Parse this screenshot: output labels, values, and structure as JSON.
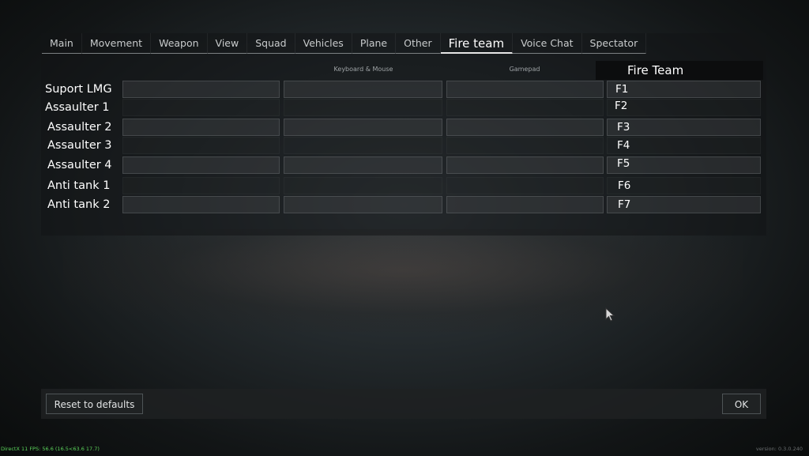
{
  "tabs": [
    {
      "label": "Main",
      "active": false
    },
    {
      "label": "Movement",
      "active": false
    },
    {
      "label": "Weapon",
      "active": false
    },
    {
      "label": "View",
      "active": false
    },
    {
      "label": "Squad",
      "active": false
    },
    {
      "label": "Vehicles",
      "active": false
    },
    {
      "label": "Plane",
      "active": false
    },
    {
      "label": "Other",
      "active": false
    },
    {
      "label": "Fire team",
      "active": true
    },
    {
      "label": "Voice Chat",
      "active": false
    },
    {
      "label": "Spectator",
      "active": false
    }
  ],
  "columns": {
    "keyboard_mouse": "Keyboard & Mouse",
    "gamepad": "Gamepad",
    "fire_team": "Fire Team"
  },
  "rows": [
    {
      "label": "Suport LMG",
      "key": "F1"
    },
    {
      "label": "Assaulter 1",
      "key": "F2"
    },
    {
      "label": "Assaulter 2",
      "key": "F3"
    },
    {
      "label": "Assaulter 3",
      "key": "F4"
    },
    {
      "label": "Assaulter 4",
      "key": "F5"
    },
    {
      "label": "Anti tank 1",
      "key": "F6"
    },
    {
      "label": "Anti tank 2",
      "key": "F7"
    }
  ],
  "buttons": {
    "reset": "Reset to defaults",
    "ok": "OK"
  },
  "status": {
    "fps": "DirectX 11 FPS: 56.6 (16.5<63.6 17.7)",
    "version": "version: 0.3.0.240"
  },
  "icons": {
    "cursor": "mouse-pointer-icon"
  }
}
